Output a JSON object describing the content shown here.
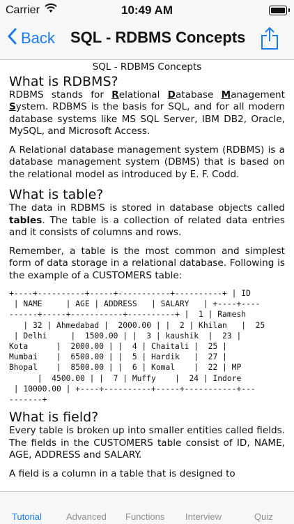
{
  "status": {
    "carrier": "Carrier",
    "time": "10:49 AM"
  },
  "nav": {
    "back_label": "Back",
    "title": "SQL - RDBMS Concepts"
  },
  "doc": {
    "title": "SQL - RDBMS Concepts",
    "sec1": {
      "heading": "What is RDBMS?",
      "p1_a": "RDBMS stands for ",
      "r": "R",
      "r_rest": "elational ",
      "d": "D",
      "d_rest": "atabase ",
      "m": "M",
      "m_rest": "anagement ",
      "s": "S",
      "s_rest": "ystem. RDBMS is the basis for SQL, and for all modern database systems like MS SQL Server, IBM DB2, Oracle, MySQL, and Microsoft Access.",
      "p2": "A Relational database management system (RDBMS) is a database management system (DBMS) that is based on the relational model as introduced by E. F. Codd."
    },
    "sec2": {
      "heading": "What is table?",
      "p1_a": "The data in RDBMS is stored in database objects called ",
      "p1_bold": "tables",
      "p1_b": ". The table is a collection of related data entries and it consists of columns and rows.",
      "p2": "Remember, a table is the most common and simplest form of data storage in a relational database. Following is the example of a CUSTOMERS table:",
      "table_lines": [
        "+----+----------+-----+-----------+----------+ | ID",
        " | NAME     | AGE | ADDRESS   | SALARY   | +----+----",
        "------+-----+-----------+----------+ |  1 | Ramesh",
        "   | 32 | Ahmedabad |  2000.00 | |  2 | Khilan   |  25",
        " | Delhi     |  1500.00 | |  3 | kaushik  |  23 |",
        "Kota      |  2000.00 | |  4 | Chaitali |  25 |",
        "Mumbai    |  6500.00 | |  5 | Hardik   |  27 |",
        "Bhopal    |  8500.00 | |  6 | Komal    |  22 | MP",
        "      |  4500.00 | |  7 | Muffy    |  24 | Indore",
        " | 10000.00 | +----+----------+-----+-----------+---",
        "-------+"
      ]
    },
    "sec3": {
      "heading": "What is field?",
      "p1": "Every table is broken up into smaller entities called fields. The fields in the CUSTOMERS table consist of ID, NAME, AGE, ADDRESS and SALARY.",
      "p2": "A field is a column in a table that is designed to"
    }
  },
  "tabs": [
    {
      "label": "Tutorial",
      "active": true
    },
    {
      "label": "Advanced"
    },
    {
      "label": "Functions"
    },
    {
      "label": "Interview"
    },
    {
      "label": "Quiz"
    }
  ],
  "colors": {
    "accent": "#1a7bf0",
    "inactive": "#8e8e93",
    "bar": "#f7f7f7"
  },
  "icons": [
    "wifi-icon",
    "battery-icon",
    "back-chevron-icon",
    "share-icon"
  ]
}
